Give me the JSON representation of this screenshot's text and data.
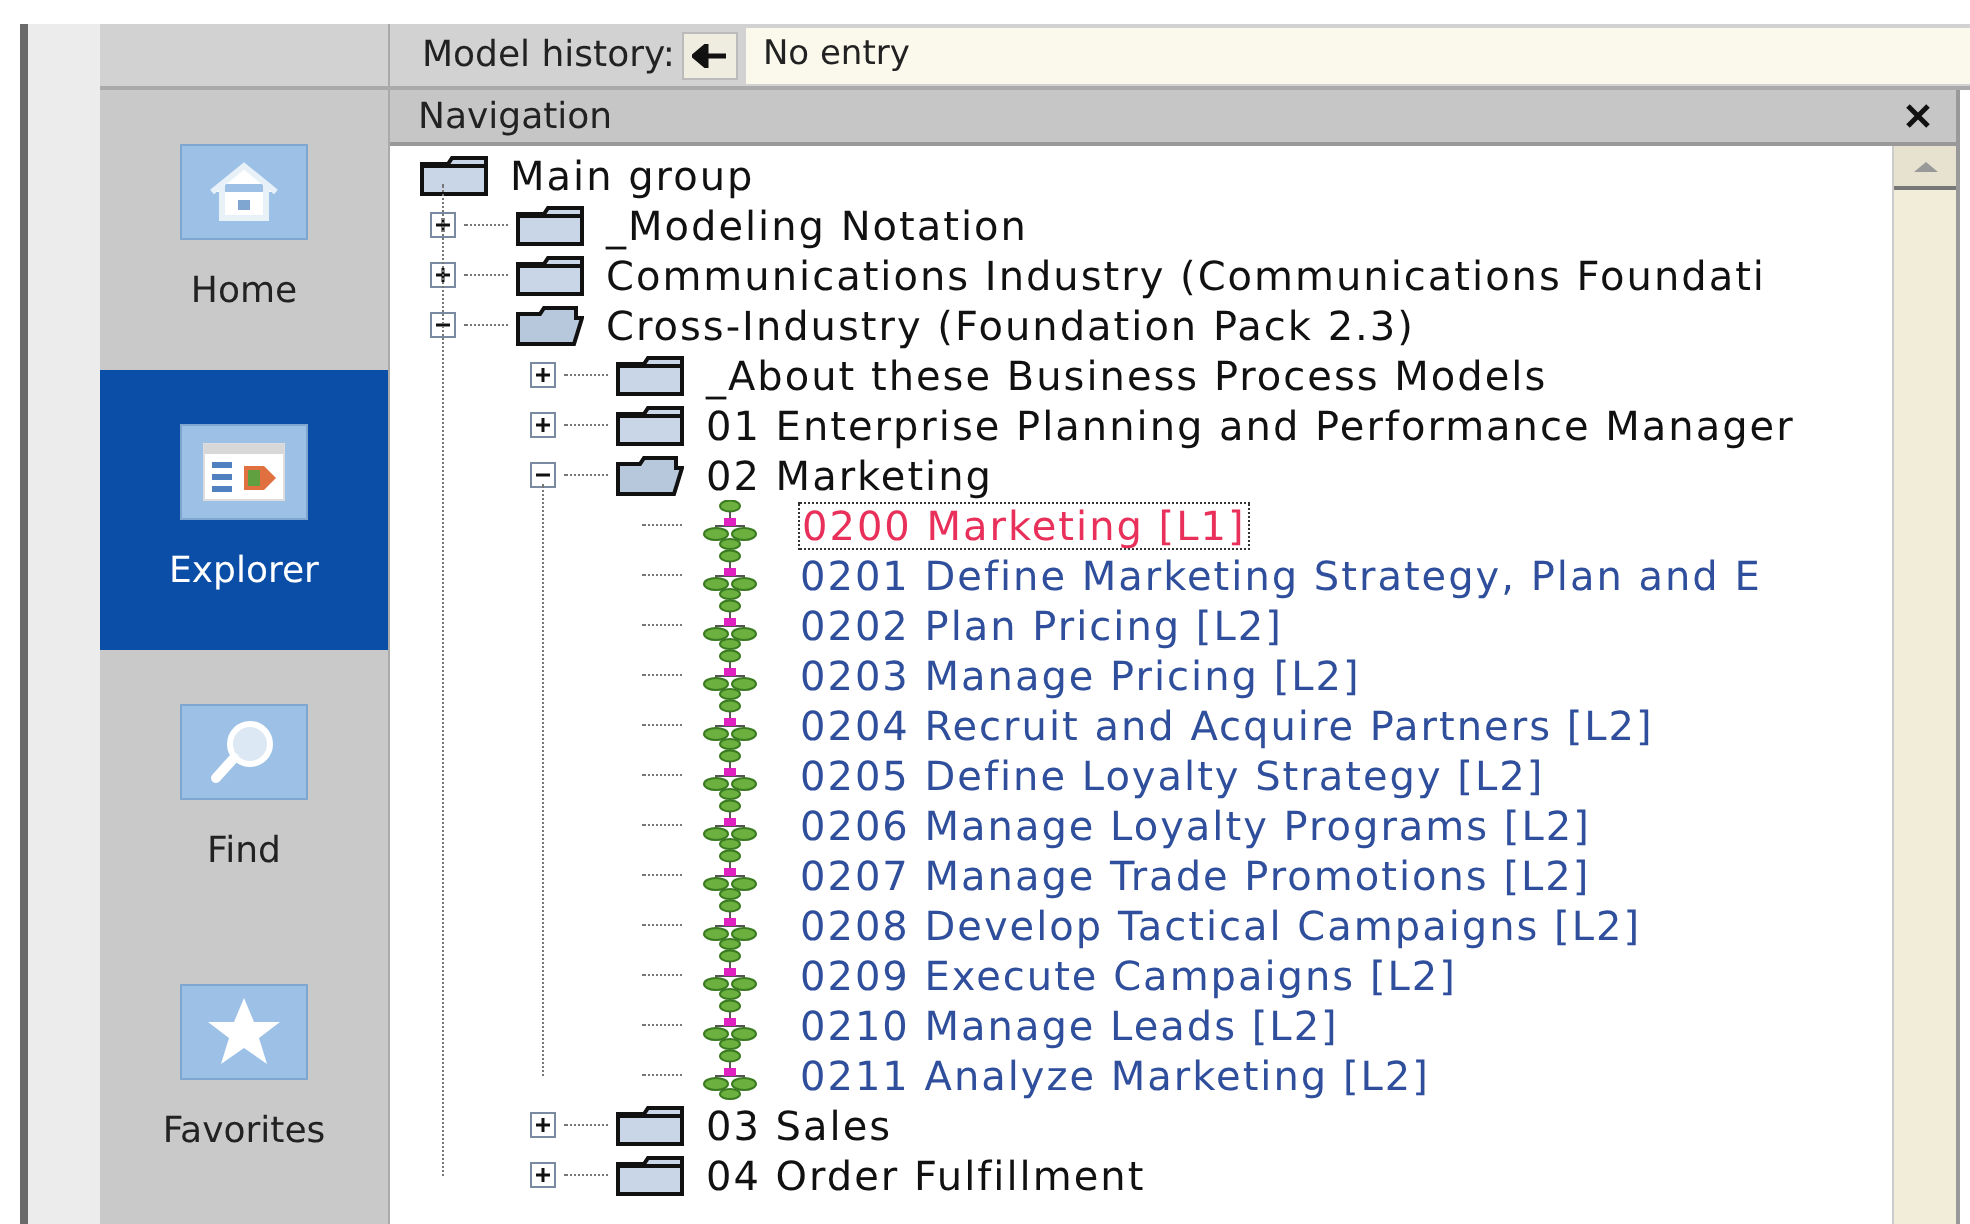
{
  "model_history": {
    "label": "Model history:",
    "value": "No entry"
  },
  "sidebar": {
    "items": [
      {
        "label": "Home",
        "kind": "home",
        "selected": false
      },
      {
        "label": "Explorer",
        "kind": "explorer",
        "selected": true
      },
      {
        "label": "Find",
        "kind": "find",
        "selected": false
      },
      {
        "label": "Favorites",
        "kind": "favorites",
        "selected": false
      }
    ]
  },
  "navigation": {
    "title": "Navigation",
    "tree": [
      {
        "label": "Main group",
        "kind": "root",
        "selected": false,
        "children": [
          {
            "label": "_Modeling Notation",
            "kind": "folder",
            "expanded": false,
            "selected": false
          },
          {
            "label": "Communications Industry (Communications Foundati",
            "kind": "folder",
            "expanded": false,
            "selected": false
          },
          {
            "label": "Cross-Industry (Foundation Pack 2.3)",
            "kind": "folder",
            "expanded": true,
            "selected": false,
            "children": [
              {
                "label": "_About these Business Process Models",
                "kind": "folder",
                "expanded": false,
                "selected": false
              },
              {
                "label": "01 Enterprise Planning and Performance Manager",
                "kind": "folder",
                "expanded": false,
                "selected": false
              },
              {
                "label": "02 Marketing",
                "kind": "folder",
                "expanded": true,
                "selected": false,
                "children": [
                  {
                    "label": "0200 Marketing [L1]",
                    "kind": "model",
                    "selected": true
                  },
                  {
                    "label": "0201 Define Marketing Strategy, Plan and E",
                    "kind": "model",
                    "selected": false
                  },
                  {
                    "label": "0202 Plan Pricing [L2]",
                    "kind": "model",
                    "selected": false
                  },
                  {
                    "label": "0203 Manage Pricing [L2]",
                    "kind": "model",
                    "selected": false
                  },
                  {
                    "label": "0204 Recruit and Acquire Partners [L2]",
                    "kind": "model",
                    "selected": false
                  },
                  {
                    "label": "0205 Define Loyalty Strategy [L2]",
                    "kind": "model",
                    "selected": false
                  },
                  {
                    "label": "0206 Manage Loyalty Programs [L2]",
                    "kind": "model",
                    "selected": false
                  },
                  {
                    "label": "0207 Manage Trade Promotions [L2]",
                    "kind": "model",
                    "selected": false
                  },
                  {
                    "label": "0208 Develop Tactical Campaigns [L2]",
                    "kind": "model",
                    "selected": false
                  },
                  {
                    "label": "0209 Execute Campaigns [L2]",
                    "kind": "model",
                    "selected": false
                  },
                  {
                    "label": "0210 Manage Leads [L2]",
                    "kind": "model",
                    "selected": false
                  },
                  {
                    "label": "0211 Analyze Marketing [L2]",
                    "kind": "model",
                    "selected": false
                  }
                ]
              },
              {
                "label": "03 Sales",
                "kind": "folder",
                "expanded": false,
                "selected": false
              },
              {
                "label": "04 Order Fulfillment",
                "kind": "folder",
                "expanded": false,
                "selected": false
              }
            ]
          }
        ]
      }
    ]
  }
}
